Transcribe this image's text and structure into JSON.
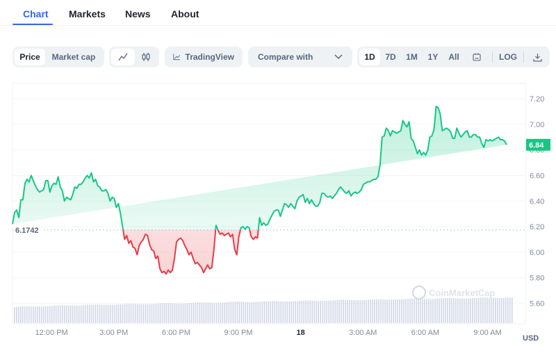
{
  "tabs": [
    {
      "label": "Chart",
      "active": true
    },
    {
      "label": "Markets",
      "active": false
    },
    {
      "label": "News",
      "active": false
    },
    {
      "label": "About",
      "active": false
    }
  ],
  "toolbar": {
    "metric_toggle": [
      {
        "label": "Price",
        "active": true
      },
      {
        "label": "Market cap",
        "active": false
      }
    ],
    "chart_type_toggle": [
      {
        "icon": "line-chart-icon",
        "active": true
      },
      {
        "icon": "candlestick-icon",
        "active": false
      }
    ],
    "tradingview_label": "TradingView",
    "compare_label": "Compare with",
    "ranges": [
      {
        "label": "1D",
        "active": true
      },
      {
        "label": "7D",
        "active": false
      },
      {
        "label": "1M",
        "active": false
      },
      {
        "label": "1Y",
        "active": false
      },
      {
        "label": "All",
        "active": false
      }
    ],
    "log_label": "LOG"
  },
  "colors": {
    "accent": "#3861fb",
    "up": "#16c784",
    "down": "#ea3943",
    "volume": "#cfd6e4"
  },
  "watermark": "CoinMarketCap",
  "chart_data": {
    "type": "line",
    "title": "",
    "xlabel": "",
    "ylabel": "USD",
    "currency_label": "USD",
    "ylim": [
      5.44,
      7.32
    ],
    "yticks": [
      7.2,
      7.0,
      6.8,
      6.6,
      6.4,
      6.2,
      6.0,
      5.8,
      5.6
    ],
    "ytick_labels": [
      "7.20",
      "7.00",
      "6.80",
      "6.60",
      "6.40",
      "6.20",
      "6.00",
      "5.80",
      "5.60"
    ],
    "xlim_hours": [
      -1.88,
      22.22
    ],
    "xticks": [
      {
        "h": 0,
        "label": "12:00 PM",
        "bold": false
      },
      {
        "h": 3,
        "label": "3:00 PM",
        "bold": false
      },
      {
        "h": 6,
        "label": "6:00 PM",
        "bold": false
      },
      {
        "h": 9,
        "label": "9:00 PM",
        "bold": false
      },
      {
        "h": 12,
        "label": "18",
        "bold": true
      },
      {
        "h": 15,
        "label": "3:00 AM",
        "bold": false
      },
      {
        "h": 18,
        "label": "6:00 AM",
        "bold": false
      },
      {
        "h": 21,
        "label": "9:00 AM",
        "bold": false
      }
    ],
    "reference_price": 6.1742,
    "reference_label": "6.1742",
    "current_price": 6.84,
    "current_label": "6.84",
    "grid": true,
    "series": [
      {
        "name": "Price",
        "x_hours": [
          -1.88,
          -1.78,
          -1.68,
          -1.58,
          -1.48,
          -1.38,
          -1.28,
          -1.18,
          -1.08,
          -0.98,
          -0.88,
          -0.78,
          -0.68,
          -0.58,
          -0.48,
          -0.38,
          -0.28,
          -0.18,
          -0.08,
          0.02,
          0.12,
          0.22,
          0.32,
          0.42,
          0.52,
          0.62,
          0.72,
          0.82,
          0.92,
          1.02,
          1.12,
          1.22,
          1.32,
          1.42,
          1.52,
          1.62,
          1.72,
          1.82,
          1.92,
          2.02,
          2.12,
          2.22,
          2.32,
          2.42,
          2.52,
          2.62,
          2.72,
          2.82,
          2.92,
          3.02,
          3.12,
          3.22,
          3.32,
          3.42,
          3.52,
          3.62,
          3.72,
          3.82,
          3.92,
          4.02,
          4.12,
          4.22,
          4.32,
          4.42,
          4.52,
          4.62,
          4.72,
          4.82,
          4.92,
          5.02,
          5.12,
          5.22,
          5.32,
          5.42,
          5.52,
          5.62,
          5.72,
          5.82,
          5.92,
          6.02,
          6.12,
          6.22,
          6.32,
          6.42,
          6.52,
          6.62,
          6.72,
          6.82,
          6.92,
          7.02,
          7.12,
          7.22,
          7.32,
          7.42,
          7.52,
          7.62,
          7.72,
          7.82,
          7.92,
          8.02,
          8.12,
          8.22,
          8.32,
          8.42,
          8.52,
          8.62,
          8.72,
          8.82,
          8.92,
          9.02,
          9.12,
          9.22,
          9.32,
          9.42,
          9.52,
          9.62,
          9.72,
          9.82,
          9.92,
          10.02,
          10.12,
          10.22,
          10.32,
          10.42,
          10.52,
          10.62,
          10.72,
          10.82,
          10.92,
          11.02,
          11.12,
          11.22,
          11.32,
          11.42,
          11.52,
          11.62,
          11.72,
          11.82,
          11.92,
          12.02,
          12.12,
          12.22,
          12.32,
          12.42,
          12.52,
          12.62,
          12.72,
          12.82,
          12.92,
          13.02,
          13.12,
          13.22,
          13.32,
          13.42,
          13.52,
          13.62,
          13.72,
          13.82,
          13.92,
          14.02,
          14.12,
          14.22,
          14.32,
          14.42,
          14.52,
          14.62,
          14.72,
          14.82,
          14.92,
          15.02,
          15.12,
          15.22,
          15.32,
          15.42,
          15.52,
          15.62,
          15.72,
          15.82,
          15.92,
          16.02,
          16.12,
          16.22,
          16.32,
          16.42,
          16.52,
          16.62,
          16.72,
          16.82,
          16.92,
          17.02,
          17.12,
          17.22,
          17.32,
          17.42,
          17.52,
          17.62,
          17.72,
          17.82,
          17.92,
          18.02,
          18.12,
          18.22,
          18.32,
          18.42,
          18.52,
          18.62,
          18.72,
          18.82,
          18.92,
          19.02,
          19.12,
          19.22,
          19.32,
          19.42,
          19.52,
          19.62,
          19.72,
          19.82,
          19.92,
          20.02,
          20.12,
          20.22,
          20.32,
          20.42,
          20.52,
          20.62,
          20.72,
          20.82,
          20.92,
          21.02,
          21.12,
          21.22,
          21.32,
          21.42,
          21.52,
          21.62,
          21.72,
          21.82,
          21.92,
          22.02,
          22.12,
          22.22
        ],
        "values": [
          6.22,
          6.31,
          6.33,
          6.27,
          6.41,
          6.41,
          6.54,
          6.57,
          6.55,
          6.6,
          6.56,
          6.52,
          6.49,
          6.47,
          6.48,
          6.49,
          6.56,
          6.56,
          6.47,
          6.52,
          6.54,
          6.53,
          6.59,
          6.51,
          6.48,
          6.4,
          6.43,
          6.42,
          6.41,
          6.45,
          6.51,
          6.5,
          6.53,
          6.53,
          6.55,
          6.58,
          6.6,
          6.58,
          6.62,
          6.55,
          6.57,
          6.52,
          6.51,
          6.48,
          6.48,
          6.49,
          6.46,
          6.4,
          6.43,
          6.42,
          6.35,
          6.38,
          6.3,
          6.2,
          6.1,
          6.13,
          6.07,
          6.09,
          6.04,
          6.03,
          5.98,
          6.05,
          6.08,
          6.1,
          6.14,
          6.13,
          6.06,
          6.02,
          6.01,
          5.95,
          5.97,
          5.87,
          5.84,
          5.85,
          5.83,
          5.86,
          5.84,
          5.86,
          5.95,
          6.08,
          6.1,
          6.11,
          6.09,
          6.05,
          6.02,
          5.98,
          6.0,
          5.95,
          5.91,
          5.92,
          5.9,
          5.88,
          5.84,
          5.87,
          5.9,
          5.87,
          5.88,
          6.02,
          6.21,
          6.17,
          6.14,
          6.15,
          6.13,
          6.14,
          6.15,
          6.12,
          6.14,
          6.02,
          5.98,
          6.12,
          6.19,
          6.2,
          6.18,
          6.2,
          6.19,
          6.12,
          6.1,
          6.12,
          6.11,
          6.27,
          6.21,
          6.23,
          6.21,
          6.22,
          6.26,
          6.29,
          6.32,
          6.33,
          6.33,
          6.28,
          6.33,
          6.38,
          6.37,
          6.35,
          6.38,
          6.36,
          6.34,
          6.4,
          6.43,
          6.44,
          6.45,
          6.39,
          6.42,
          6.38,
          6.41,
          6.38,
          6.36,
          6.36,
          6.39,
          6.46,
          6.46,
          6.44,
          6.43,
          6.44,
          6.42,
          6.44,
          6.46,
          6.49,
          6.51,
          6.49,
          6.47,
          6.46,
          6.48,
          6.44,
          6.46,
          6.47,
          6.46,
          6.47,
          6.49,
          6.53,
          6.54,
          6.55,
          6.55,
          6.56,
          6.57,
          6.57,
          6.59,
          6.68,
          6.9,
          6.91,
          6.97,
          6.95,
          6.91,
          6.95,
          6.94,
          6.93,
          6.94,
          6.95,
          7.03,
          7.0,
          6.98,
          7.02,
          6.89,
          6.87,
          6.82,
          6.77,
          6.8,
          6.76,
          6.78,
          6.76,
          6.8,
          6.9,
          6.91,
          6.96,
          7.14,
          7.13,
          7.08,
          6.95,
          6.96,
          6.97,
          6.96,
          6.94,
          6.89,
          6.89,
          6.97,
          6.93,
          6.9,
          6.92,
          6.94,
          6.95,
          6.9,
          6.9,
          6.92,
          6.92,
          6.9,
          6.9,
          6.85,
          6.82,
          6.88,
          6.87,
          6.88,
          6.87,
          6.88,
          6.89,
          6.9,
          6.88,
          6.88,
          6.87,
          6.84
        ]
      },
      {
        "name": "Volume (relative)",
        "x_hours_range": [
          -1.88,
          22.22
        ],
        "relative_values_start": 0.42,
        "relative_values_end": 0.7
      }
    ]
  }
}
